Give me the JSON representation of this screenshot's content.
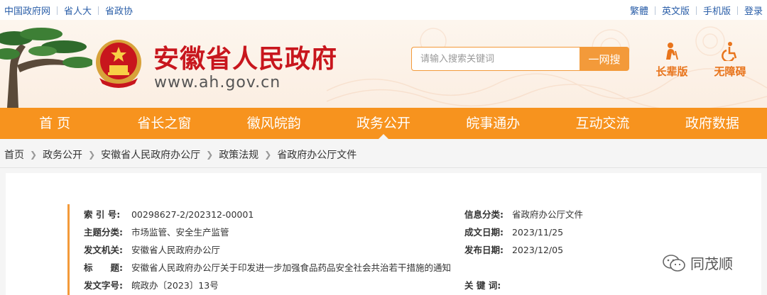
{
  "topbar": {
    "links_left": [
      "中国政府网",
      "省人大",
      "省政协"
    ],
    "links_right": [
      "繁體",
      "英文版",
      "手机版",
      "登录"
    ]
  },
  "header": {
    "title": "安徽省人民政府",
    "url": "www.ah.gov.cn",
    "search_placeholder": "请输入搜索关键词",
    "search_button": "一网搜",
    "elder_label": "长辈版",
    "access_label": "无障碍"
  },
  "nav": {
    "items": [
      "首 页",
      "省长之窗",
      "徽风皖韵",
      "政务公开",
      "皖事通办",
      "互动交流",
      "政府数据"
    ],
    "active": "政务公开"
  },
  "breadcrumb": [
    "首页",
    "政务公开",
    "安徽省人民政府办公厅",
    "政策法规",
    "省政府办公厅文件"
  ],
  "meta": {
    "index_label": "索 引 号:",
    "index_value": "00298627-2/202312-00001",
    "category_label": "信息分类:",
    "category_value": "省政府办公厅文件",
    "topic_label": "主题分类:",
    "topic_value": "市场监管、安全生产监管",
    "date_made_label": "成文日期:",
    "date_made_value": "2023/11/25",
    "issuer_label": "发文机关:",
    "issuer_value": "安徽省人民政府办公厅",
    "publish_label": "发布日期:",
    "publish_value": "2023/12/05",
    "title_label": "标　　题:",
    "title_value": "安徽省人民政府办公厅关于印发进一步加强食品药品安全社会共治若干措施的通知",
    "docno_label": "发文字号:",
    "docno_value": "皖政办〔2023〕13号",
    "keywords_label": "关 键 词:",
    "keywords_value": ""
  },
  "watermark": "同茂顺",
  "colors": {
    "brand_red": "#c8161d",
    "nav_orange": "#f7931e",
    "link_blue": "#2a5ea8"
  }
}
